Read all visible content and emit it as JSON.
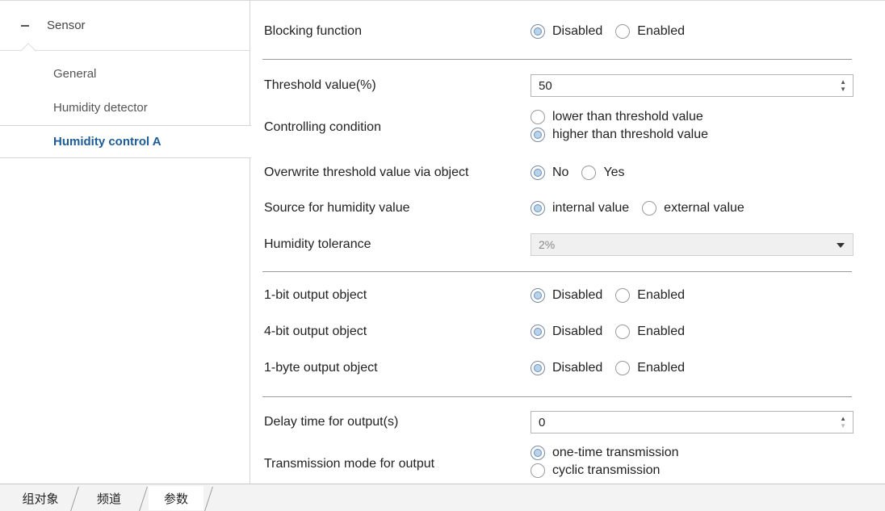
{
  "sidebar": {
    "group_label": "Sensor",
    "items": [
      {
        "label": "General"
      },
      {
        "label": "Humidity detector"
      },
      {
        "label": "Humidity control A",
        "active": true
      }
    ]
  },
  "form": {
    "blocking": {
      "label": "Blocking function",
      "options": [
        "Disabled",
        "Enabled"
      ],
      "selected": "Disabled"
    },
    "threshold": {
      "label": "Threshold value(%)",
      "value": "50"
    },
    "condition": {
      "label": "Controlling condition",
      "options": [
        "lower than threshold value",
        "higher than threshold value"
      ],
      "selected": "higher than threshold value"
    },
    "overwrite": {
      "label": "Overwrite threshold value via object",
      "options": [
        "No",
        "Yes"
      ],
      "selected": "No"
    },
    "source": {
      "label": "Source for humidity value",
      "options": [
        "internal value",
        "external value"
      ],
      "selected": "internal value"
    },
    "tolerance": {
      "label": "Humidity tolerance",
      "value": "2%"
    },
    "out1bit": {
      "label": "1-bit output object",
      "options": [
        "Disabled",
        "Enabled"
      ],
      "selected": "Disabled"
    },
    "out4bit": {
      "label": "4-bit output object",
      "options": [
        "Disabled",
        "Enabled"
      ],
      "selected": "Disabled"
    },
    "out1byte": {
      "label": "1-byte output object",
      "options": [
        "Disabled",
        "Enabled"
      ],
      "selected": "Disabled"
    },
    "delay": {
      "label": "Delay time for output(s)",
      "value": "0"
    },
    "transmission": {
      "label": "Transmission mode for output",
      "options": [
        "one-time transmission",
        "cyclic transmission"
      ],
      "selected": "one-time transmission"
    }
  },
  "tabs": [
    {
      "label": "组对象"
    },
    {
      "label": "频道"
    },
    {
      "label": "参数",
      "active": true
    }
  ],
  "colors": {
    "accent": "#1d5c96",
    "radio_fill": "#b7d3ee"
  },
  "icons": {
    "collapse": "minus-icon",
    "spin_up": "triangle-up-icon",
    "spin_down": "triangle-down-icon",
    "dropdown": "caret-down-icon"
  }
}
